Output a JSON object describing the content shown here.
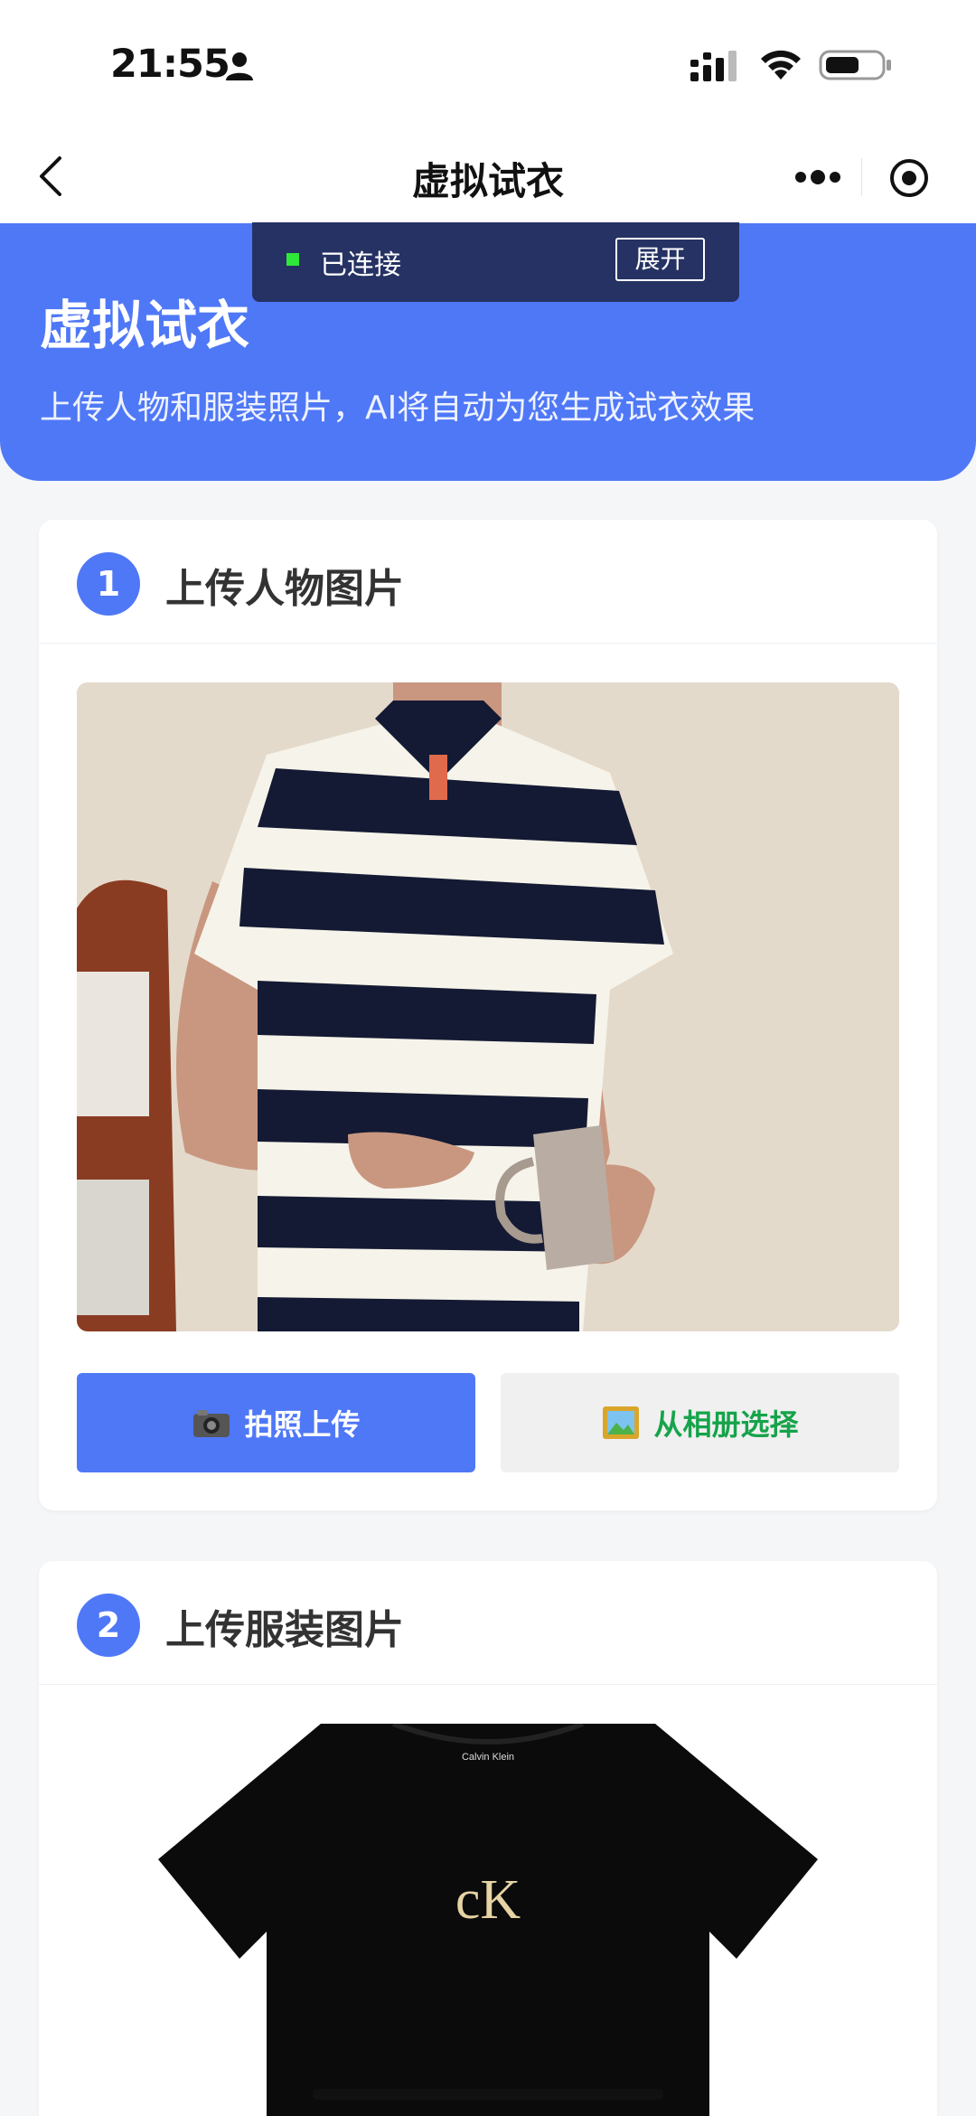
{
  "status_bar": {
    "time": "21:55",
    "icons": [
      "person-icon",
      "signal-icon",
      "wifi-icon",
      "battery-icon"
    ]
  },
  "nav": {
    "title": "虚拟试衣",
    "back_icon": "chevron-left-icon",
    "more_icon": "more-icon",
    "close_icon": "target-icon"
  },
  "hero": {
    "title": "虚拟试衣",
    "subtitle": "上传人物和服装照片，AI将自动为您生成试衣效果",
    "color": "#4f78f7"
  },
  "connection": {
    "status": "已连接",
    "expand_label": "展开",
    "status_color": "#2ee83a"
  },
  "steps": [
    {
      "number": "1",
      "title": "上传人物图片",
      "buttons": {
        "camera_label": "拍照上传",
        "album_label": "从相册选择"
      }
    },
    {
      "number": "2",
      "title": "上传服装图片",
      "garment_brand": "Calvin Klein",
      "garment_logo": "cK"
    }
  ],
  "colors": {
    "primary": "#4f78f7",
    "album_text": "#16a34a",
    "background": "#f5f6f8"
  }
}
